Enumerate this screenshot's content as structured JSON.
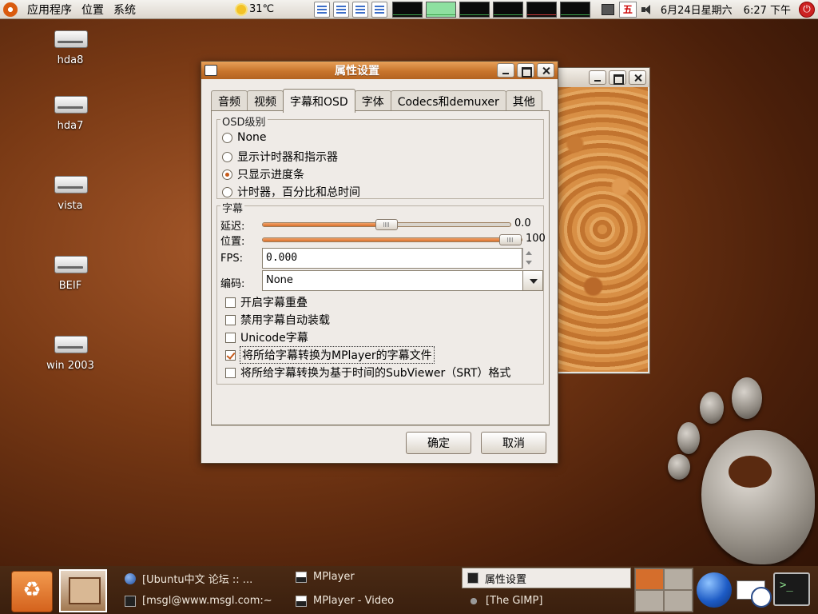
{
  "top_panel": {
    "menus": [
      "应用程序",
      "位置",
      "系统"
    ],
    "weather": "31℃",
    "ime_indicator": "五",
    "date": "6月24日星期六",
    "time": "6:27 下午"
  },
  "desktop_icons": [
    {
      "label": "hda8",
      "icon": "drive-icon"
    },
    {
      "label": "hda7",
      "icon": "drive-icon"
    },
    {
      "label": "vista",
      "icon": "drive-icon"
    },
    {
      "label": "BEIF",
      "icon": "drive-icon"
    },
    {
      "label": "win 2003",
      "icon": "drive-icon"
    }
  ],
  "dialog": {
    "title": "属性设置",
    "tabs": [
      "音频",
      "视频",
      "字幕和OSD",
      "字体",
      "Codecs和demuxer",
      "其他"
    ],
    "active_tab": 2,
    "osd_group": {
      "title": "OSD级别",
      "options": [
        "None",
        "显示计时器和指示器",
        "只显示进度条",
        "计时器，百分比和总时间"
      ],
      "selected": 2
    },
    "subtitle_group": {
      "title": "字幕",
      "delay_label": "延迟:",
      "delay_value": "0.0",
      "delay_fraction": 0.5,
      "position_label": "位置:",
      "position_value": "100",
      "position_fraction": 1.0,
      "fps_label": "FPS:",
      "fps_value": "0.000",
      "encoding_label": "编码:",
      "encoding_value": "None",
      "checkboxes": [
        {
          "label": "开启字幕重叠",
          "checked": false
        },
        {
          "label": "禁用字幕自动装载",
          "checked": false
        },
        {
          "label": "Unicode字幕",
          "checked": false
        },
        {
          "label": "将所给字幕转换为MPlayer的字幕文件",
          "checked": true
        },
        {
          "label": "将所给字幕转换为基于时间的SubViewer（SRT）格式",
          "checked": false
        }
      ]
    },
    "ok_label": "确定",
    "cancel_label": "取消"
  },
  "taskbar": {
    "tasks": [
      {
        "label": "[Ubuntu中文 论坛 :: ...",
        "icon": "globe-icon"
      },
      {
        "label": "MPlayer",
        "icon": "mplayer-icon"
      },
      {
        "label": "属性设置",
        "icon": "dialog-icon",
        "active": true
      },
      {
        "label": "[msgl@www.msgl.com:~",
        "icon": "terminal-icon"
      },
      {
        "label": "MPlayer - Video",
        "icon": "mplayer-icon"
      },
      {
        "label": "[The GIMP]",
        "icon": "gimp-icon"
      }
    ]
  },
  "colors": {
    "accent": "#d96f2a",
    "titlebar": "#c8752c",
    "panel": "#e4ded5"
  }
}
